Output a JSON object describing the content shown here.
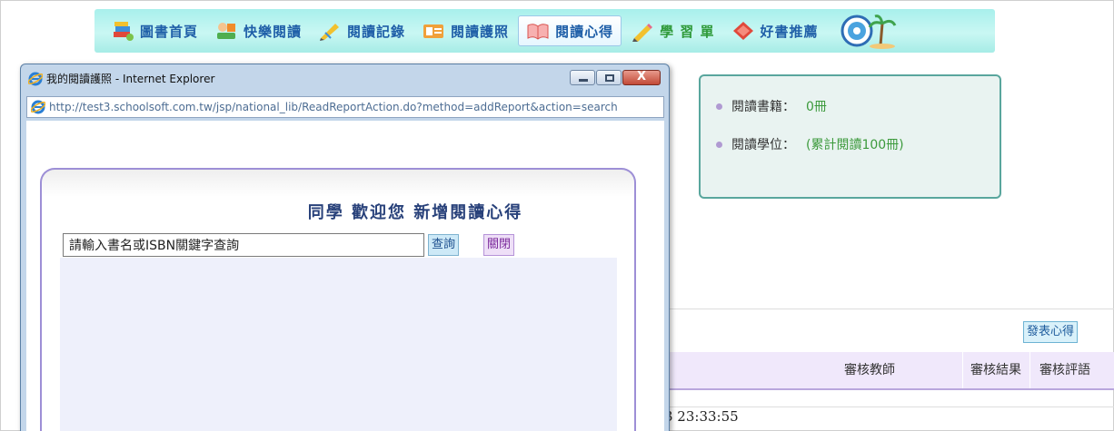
{
  "nav": {
    "items": [
      {
        "label": "圖書首頁",
        "icon": "book-stack-icon"
      },
      {
        "label": "快樂閱讀",
        "icon": "reading-kid-icon"
      },
      {
        "label": "閱讀記錄",
        "icon": "pencil-note-icon"
      },
      {
        "label": "閱讀護照",
        "icon": "passport-icon"
      },
      {
        "label": "閱讀心得",
        "icon": "open-book-icon"
      },
      {
        "label": "學 習 單",
        "icon": "pencil-icon"
      },
      {
        "label": "好書推薦",
        "icon": "diamond-book-icon"
      }
    ],
    "active_index": 4
  },
  "stats": {
    "books_label": "閱讀書籍：",
    "books_value": "0冊",
    "degree_label": "閱讀學位：",
    "degree_value": "(累計閱讀100冊)"
  },
  "main": {
    "post_button": "發表心得",
    "columns": [
      "審核教師",
      "審核結果",
      "審核評語"
    ],
    "partial_time": "3 23:33:55"
  },
  "ie_window": {
    "title": "我的閱讀護照 - Internet Explorer",
    "url": "http://test3.schoolsoft.com.tw/jsp/national_lib/ReadReportAction.do?method=addReport&action=search",
    "close_glyph": "X"
  },
  "panel": {
    "title": "同學 歡迎您 新增閱讀心得",
    "search_value": "請輸入書名或ISBN關鍵字查詢",
    "query_button": "查詢",
    "close_button": "關閉"
  },
  "colors": {
    "nav_bg": "#b8f3ee",
    "nav_text": "#1f5fa8",
    "info_border": "#59a69d",
    "panel_border": "#9d8fd6",
    "value_green": "#3c9a3c"
  }
}
